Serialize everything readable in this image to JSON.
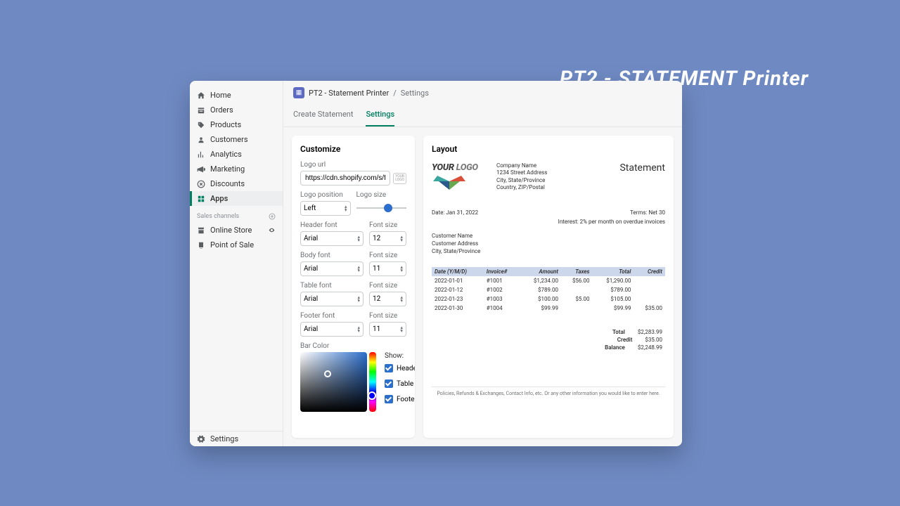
{
  "banner": "PT2 - STATEMENT  Printer",
  "sidebar": {
    "items": [
      {
        "label": "Home"
      },
      {
        "label": "Orders"
      },
      {
        "label": "Products"
      },
      {
        "label": "Customers"
      },
      {
        "label": "Analytics"
      },
      {
        "label": "Marketing"
      },
      {
        "label": "Discounts"
      },
      {
        "label": "Apps"
      }
    ],
    "channels_header": "Sales channels",
    "channels": [
      {
        "label": "Online Store"
      },
      {
        "label": "Point of Sale"
      }
    ],
    "footer": "Settings"
  },
  "breadcrumb": {
    "app": "PT2 - Statement Printer",
    "page": "Settings"
  },
  "tabs": [
    {
      "label": "Create Statement"
    },
    {
      "label": "Settings"
    }
  ],
  "customize": {
    "title": "Customize",
    "logo_url_label": "Logo url",
    "logo_url": "https://cdn.shopify.com/s/file",
    "logo_position_label": "Logo position",
    "logo_position": "Left",
    "logo_size_label": "Logo size",
    "header_font_label": "Header font",
    "header_font": "Arial",
    "header_size_label": "Font size",
    "header_size": "12",
    "body_font_label": "Body font",
    "body_font": "Arial",
    "body_size_label": "Font size",
    "body_size": "11",
    "table_font_label": "Table font",
    "table_font": "Arial",
    "table_size_label": "Font size",
    "table_size": "12",
    "footer_font_label": "Footer font",
    "footer_font": "Arial",
    "footer_size_label": "Font size",
    "footer_size": "11",
    "bar_color_label": "Bar Color",
    "show_label": "Show:",
    "show_header": "Header",
    "show_table": "Table",
    "show_footer": "Footer"
  },
  "layout": {
    "title": "Layout",
    "logo_text": "YOUR LOGO",
    "company": {
      "name": "Company Name",
      "street": "1234 Street Address",
      "city": "City, State/Province",
      "country": "Country, ZIP/Postal"
    },
    "statement": "Statement",
    "date_label": "Date: Jan 31, 2022",
    "terms": "Terms: Net 30",
    "interest": "Interest: 2% per month on overdue invoices",
    "customer": {
      "name": "Customer Name",
      "addr": "Customer Address",
      "city": "City, State/Province"
    },
    "columns": [
      "Date (Y/M/D)",
      "Invoice#",
      "Amount",
      "Taxes",
      "Total",
      "Credit"
    ],
    "rows": [
      [
        "2022-01-01",
        "#1001",
        "$1,234.00",
        "$56.00",
        "$1,290.00",
        ""
      ],
      [
        "2022-01-12",
        "#1002",
        "$789.00",
        "",
        "$789.00",
        ""
      ],
      [
        "2022-01-23",
        "#1003",
        "$100.00",
        "$5.00",
        "$105.00",
        ""
      ],
      [
        "2022-01-30",
        "#1004",
        "$99.99",
        "",
        "$99.99",
        "$35.00"
      ]
    ],
    "summary": {
      "total_label": "Total",
      "total": "$2,283.99",
      "credit_label": "Credit",
      "credit": "$35.00",
      "balance_label": "Balance",
      "balance": "$2,248.99"
    },
    "footer": "Policies, Refunds & Exchanges, Contact Info, etc.  Or any other information you would like to enter here."
  }
}
